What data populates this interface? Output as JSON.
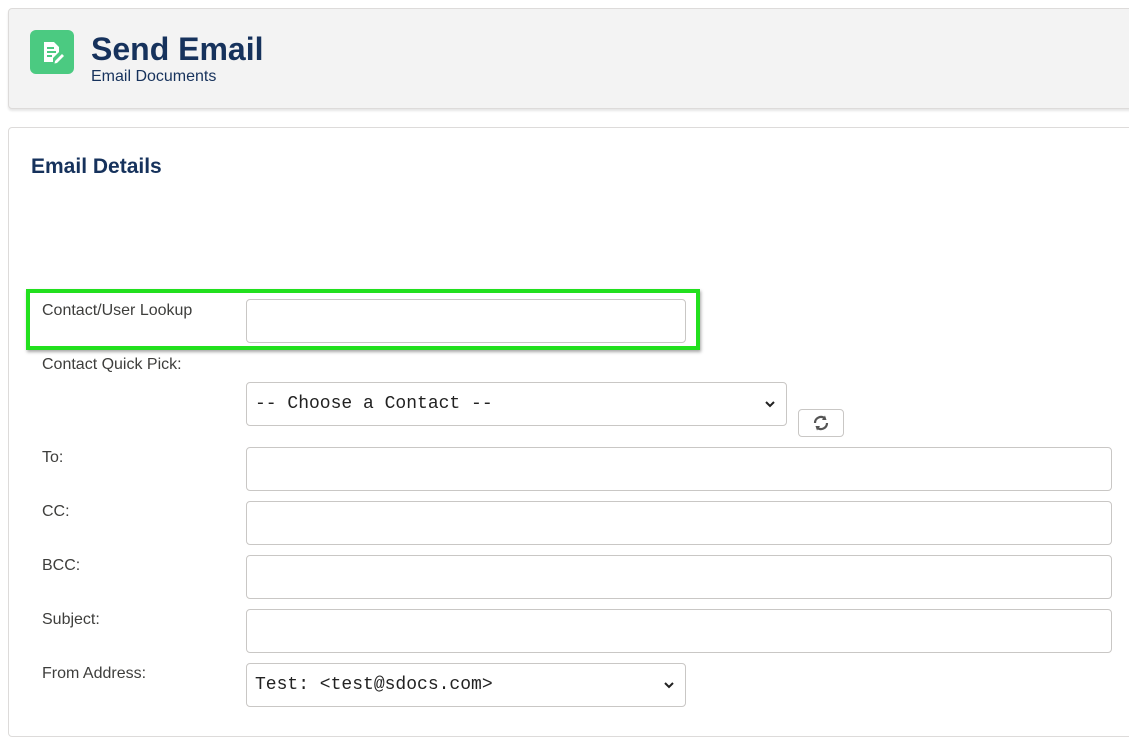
{
  "header": {
    "title": "Send Email",
    "subtitle": "Email Documents",
    "icon": "document-edit-icon",
    "icon_color": "#4bca81"
  },
  "card": {
    "title": "Email Details"
  },
  "form": {
    "lookup_label": "Contact/User Lookup",
    "lookup_value": "",
    "quick_pick_label": "Contact Quick Pick:",
    "quick_pick_selected": "-- Choose a Contact --",
    "refresh_icon": "refresh-icon",
    "to_label": "To:",
    "to_value": "",
    "cc_label": "CC:",
    "cc_value": "",
    "bcc_label": "BCC:",
    "bcc_value": "",
    "subject_label": "Subject:",
    "subject_value": "",
    "from_label": "From Address:",
    "from_selected": "Test: <test@sdocs.com>"
  },
  "colors": {
    "highlight": "#22e01e",
    "title_text": "#16325c"
  }
}
